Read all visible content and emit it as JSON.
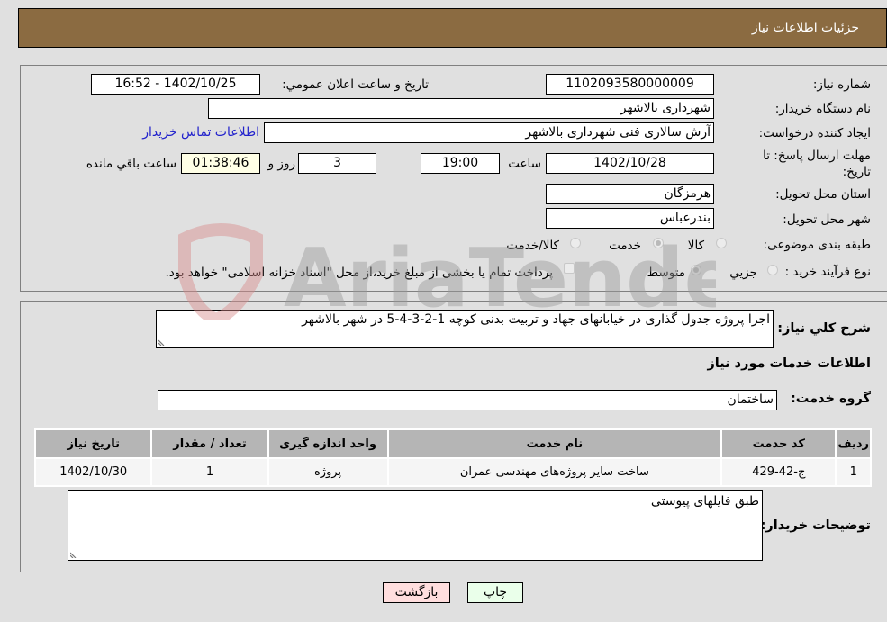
{
  "header": {
    "title": "جزئیات اطلاعات نیاز"
  },
  "form": {
    "need_number": {
      "label": "شماره نیاز:",
      "value": "1102093580000009"
    },
    "announce_datetime": {
      "label": "تاریخ و ساعت اعلان عمومي:",
      "value": "1402/10/25 - 16:52"
    },
    "buyer_org": {
      "label": "نام دستگاه خریدار:",
      "value": "شهرداری بالاشهر"
    },
    "requester": {
      "label": "ایجاد کننده درخواست:",
      "value": "آرش سالاری فنی شهرداری بالاشهر"
    },
    "buyer_contact_link": "اطلاعات تماس خریدار",
    "deadline": {
      "label_line1": "مهلت ارسال پاسخ: تا",
      "label_line2": "تاریخ:",
      "date": "1402/10/28",
      "time_label": "ساعت",
      "time": "19:00",
      "days": "3",
      "days_label": "روز و",
      "remaining": "01:38:46",
      "remaining_label": "ساعت باقي مانده"
    },
    "province": {
      "label": "استان محل تحویل:",
      "value": "هرمزگان"
    },
    "city": {
      "label": "شهر محل تحویل:",
      "value": "بندرعباس"
    },
    "category": {
      "label": "طبقه بندی موضوعی:",
      "options": [
        "کالا",
        "خدمت",
        "کالا/خدمت"
      ],
      "selected": "خدمت"
    },
    "purchase_process": {
      "label": "نوع فرآیند خرید :",
      "options": [
        "جزیي",
        "متوسط"
      ],
      "selected": "متوسط",
      "payment_note": "پرداخت تمام یا بخشی از مبلغ خرید،از محل \"اسناد خزانه اسلامی\" خواهد بود."
    }
  },
  "description": {
    "label": "شرح کلي نیاز:",
    "value": "اجرا پروژه جدول گذاری در خیابانهای جهاد و تربیت بدنی کوچه 1-2-3-4-5 در شهر بالاشهر"
  },
  "services_section": {
    "title": "اطلاعات خدمات مورد نیاز"
  },
  "service_group": {
    "label": "گروه خدمت:",
    "value": "ساختمان"
  },
  "services_table": {
    "headers": [
      "ردیف",
      "کد خدمت",
      "نام خدمت",
      "واحد اندازه گیری",
      "تعداد / مقدار",
      "تاریخ نیاز"
    ],
    "rows": [
      [
        "1",
        "ج-42-429",
        "ساخت سایر پروژه‌های مهندسی عمران",
        "پروژه",
        "1",
        "1402/10/30"
      ]
    ]
  },
  "buyer_notes": {
    "label": "توضیحات خریدار:",
    "value": "طبق فایلهای پیوستی"
  },
  "buttons": {
    "print": "چاپ",
    "back": "بازگشت"
  },
  "watermark": {
    "text": "AriaTender.neT"
  },
  "colors": {
    "header_bg": "#8b6b41",
    "link": "#2222cc",
    "print_bg": "#eaffea",
    "back_bg": "#ffdede",
    "remaining_bg": "#ffffe6"
  }
}
